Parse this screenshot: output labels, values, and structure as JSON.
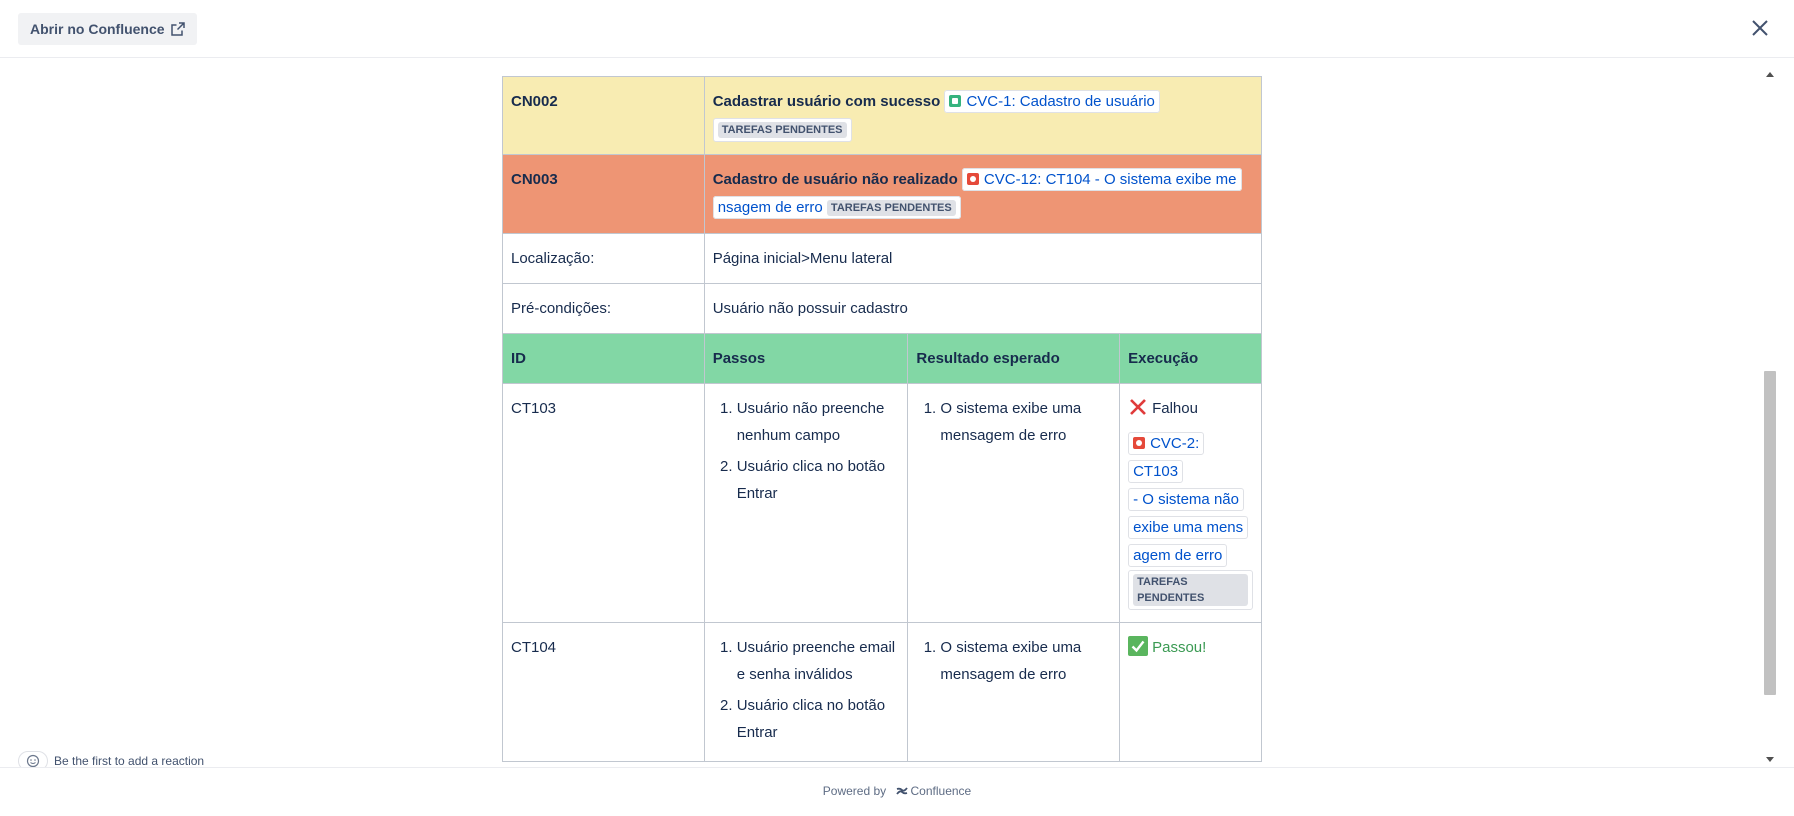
{
  "header": {
    "open_button_label": "Abrir no Confluence",
    "open_icon": "external-link-icon",
    "close_icon": "close-icon"
  },
  "table": {
    "cn002": {
      "id": "CN002",
      "title": "Cadastrar usuário com sucesso",
      "issue_link": "CVC-1: Cadastro de usuário",
      "issue_type": "story-icon",
      "status": "TAREFAS PENDENTES"
    },
    "cn003": {
      "id": "CN003",
      "title": "Cadastro de usuário não realizado",
      "issue_link": "CVC-12: CT104 - O sistema exibe mensagem de erro",
      "issue_link_line1": "CVC-12: CT104 - O sistema exibe me",
      "issue_link_line2": "nsagem de erro",
      "issue_type": "bug-icon",
      "status": "TAREFAS PENDENTES"
    },
    "location": {
      "label": "Localização:",
      "value": "Página inicial>Menu lateral"
    },
    "preconditions": {
      "label": "Pré-condições:",
      "value": "Usuário não possuir cadastro"
    },
    "headers": [
      "ID",
      "Passos",
      "Resultado esperado",
      "Execução"
    ],
    "rows": [
      {
        "id": "CT103",
        "steps": [
          "Usuário não preenche nenhum campo",
          "Usuário clica no botão Entrar"
        ],
        "expected": [
          "O sistema exibe uma mensagem de erro"
        ],
        "result": "Falhou",
        "result_icon": "cross-mark-icon",
        "issue_link_lines": [
          "CVC-2: CT103",
          "- O sistema não",
          "exibe uma mens",
          "agem de erro"
        ],
        "issue_type": "bug-icon",
        "status": "TAREFAS PENDENTES"
      },
      {
        "id": "CT104",
        "steps": [
          "Usuário preenche email e senha inválidos",
          "Usuário clica no botão Entrar"
        ],
        "expected": [
          "O sistema exibe uma mensagem de erro"
        ],
        "result": "Passou!",
        "result_icon": "check-mark-icon"
      }
    ],
    "colors": {
      "yellow": "#f8ecb2",
      "orange": "#ee9574",
      "green": "#82d7a5"
    }
  },
  "footer": {
    "reaction_text": "Be the first to add a reaction",
    "powered_by": "Powered by",
    "brand": "Confluence"
  }
}
